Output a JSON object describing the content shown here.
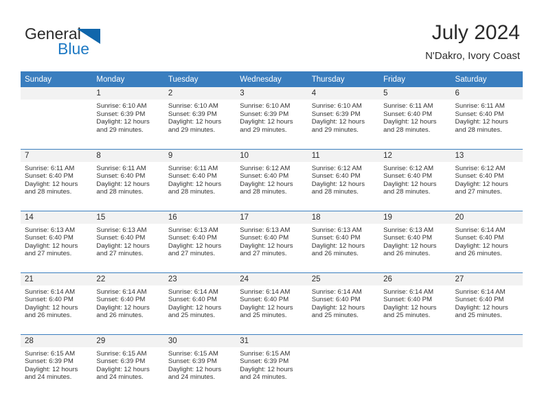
{
  "brand": {
    "name_part1": "General",
    "name_part2": "Blue",
    "triangle_icon": "triangle-icon",
    "accent_color": "#1f7ac4"
  },
  "header": {
    "title": "July 2024",
    "subtitle": "N'Dakro, Ivory Coast"
  },
  "theme": {
    "header_bg": "#3a7ebf",
    "daynum_bg": "#f2f2f2",
    "row_divider": "#3a7ebf",
    "text": "#333333"
  },
  "weekdays": [
    "Sunday",
    "Monday",
    "Tuesday",
    "Wednesday",
    "Thursday",
    "Friday",
    "Saturday"
  ],
  "weeks": [
    [
      {
        "day": "",
        "sunrise": "",
        "sunset": "",
        "daylight1": "",
        "daylight2": ""
      },
      {
        "day": "1",
        "sunrise": "Sunrise: 6:10 AM",
        "sunset": "Sunset: 6:39 PM",
        "daylight1": "Daylight: 12 hours",
        "daylight2": "and 29 minutes."
      },
      {
        "day": "2",
        "sunrise": "Sunrise: 6:10 AM",
        "sunset": "Sunset: 6:39 PM",
        "daylight1": "Daylight: 12 hours",
        "daylight2": "and 29 minutes."
      },
      {
        "day": "3",
        "sunrise": "Sunrise: 6:10 AM",
        "sunset": "Sunset: 6:39 PM",
        "daylight1": "Daylight: 12 hours",
        "daylight2": "and 29 minutes."
      },
      {
        "day": "4",
        "sunrise": "Sunrise: 6:10 AM",
        "sunset": "Sunset: 6:39 PM",
        "daylight1": "Daylight: 12 hours",
        "daylight2": "and 29 minutes."
      },
      {
        "day": "5",
        "sunrise": "Sunrise: 6:11 AM",
        "sunset": "Sunset: 6:40 PM",
        "daylight1": "Daylight: 12 hours",
        "daylight2": "and 28 minutes."
      },
      {
        "day": "6",
        "sunrise": "Sunrise: 6:11 AM",
        "sunset": "Sunset: 6:40 PM",
        "daylight1": "Daylight: 12 hours",
        "daylight2": "and 28 minutes."
      }
    ],
    [
      {
        "day": "7",
        "sunrise": "Sunrise: 6:11 AM",
        "sunset": "Sunset: 6:40 PM",
        "daylight1": "Daylight: 12 hours",
        "daylight2": "and 28 minutes."
      },
      {
        "day": "8",
        "sunrise": "Sunrise: 6:11 AM",
        "sunset": "Sunset: 6:40 PM",
        "daylight1": "Daylight: 12 hours",
        "daylight2": "and 28 minutes."
      },
      {
        "day": "9",
        "sunrise": "Sunrise: 6:11 AM",
        "sunset": "Sunset: 6:40 PM",
        "daylight1": "Daylight: 12 hours",
        "daylight2": "and 28 minutes."
      },
      {
        "day": "10",
        "sunrise": "Sunrise: 6:12 AM",
        "sunset": "Sunset: 6:40 PM",
        "daylight1": "Daylight: 12 hours",
        "daylight2": "and 28 minutes."
      },
      {
        "day": "11",
        "sunrise": "Sunrise: 6:12 AM",
        "sunset": "Sunset: 6:40 PM",
        "daylight1": "Daylight: 12 hours",
        "daylight2": "and 28 minutes."
      },
      {
        "day": "12",
        "sunrise": "Sunrise: 6:12 AM",
        "sunset": "Sunset: 6:40 PM",
        "daylight1": "Daylight: 12 hours",
        "daylight2": "and 28 minutes."
      },
      {
        "day": "13",
        "sunrise": "Sunrise: 6:12 AM",
        "sunset": "Sunset: 6:40 PM",
        "daylight1": "Daylight: 12 hours",
        "daylight2": "and 27 minutes."
      }
    ],
    [
      {
        "day": "14",
        "sunrise": "Sunrise: 6:13 AM",
        "sunset": "Sunset: 6:40 PM",
        "daylight1": "Daylight: 12 hours",
        "daylight2": "and 27 minutes."
      },
      {
        "day": "15",
        "sunrise": "Sunrise: 6:13 AM",
        "sunset": "Sunset: 6:40 PM",
        "daylight1": "Daylight: 12 hours",
        "daylight2": "and 27 minutes."
      },
      {
        "day": "16",
        "sunrise": "Sunrise: 6:13 AM",
        "sunset": "Sunset: 6:40 PM",
        "daylight1": "Daylight: 12 hours",
        "daylight2": "and 27 minutes."
      },
      {
        "day": "17",
        "sunrise": "Sunrise: 6:13 AM",
        "sunset": "Sunset: 6:40 PM",
        "daylight1": "Daylight: 12 hours",
        "daylight2": "and 27 minutes."
      },
      {
        "day": "18",
        "sunrise": "Sunrise: 6:13 AM",
        "sunset": "Sunset: 6:40 PM",
        "daylight1": "Daylight: 12 hours",
        "daylight2": "and 26 minutes."
      },
      {
        "day": "19",
        "sunrise": "Sunrise: 6:13 AM",
        "sunset": "Sunset: 6:40 PM",
        "daylight1": "Daylight: 12 hours",
        "daylight2": "and 26 minutes."
      },
      {
        "day": "20",
        "sunrise": "Sunrise: 6:14 AM",
        "sunset": "Sunset: 6:40 PM",
        "daylight1": "Daylight: 12 hours",
        "daylight2": "and 26 minutes."
      }
    ],
    [
      {
        "day": "21",
        "sunrise": "Sunrise: 6:14 AM",
        "sunset": "Sunset: 6:40 PM",
        "daylight1": "Daylight: 12 hours",
        "daylight2": "and 26 minutes."
      },
      {
        "day": "22",
        "sunrise": "Sunrise: 6:14 AM",
        "sunset": "Sunset: 6:40 PM",
        "daylight1": "Daylight: 12 hours",
        "daylight2": "and 26 minutes."
      },
      {
        "day": "23",
        "sunrise": "Sunrise: 6:14 AM",
        "sunset": "Sunset: 6:40 PM",
        "daylight1": "Daylight: 12 hours",
        "daylight2": "and 25 minutes."
      },
      {
        "day": "24",
        "sunrise": "Sunrise: 6:14 AM",
        "sunset": "Sunset: 6:40 PM",
        "daylight1": "Daylight: 12 hours",
        "daylight2": "and 25 minutes."
      },
      {
        "day": "25",
        "sunrise": "Sunrise: 6:14 AM",
        "sunset": "Sunset: 6:40 PM",
        "daylight1": "Daylight: 12 hours",
        "daylight2": "and 25 minutes."
      },
      {
        "day": "26",
        "sunrise": "Sunrise: 6:14 AM",
        "sunset": "Sunset: 6:40 PM",
        "daylight1": "Daylight: 12 hours",
        "daylight2": "and 25 minutes."
      },
      {
        "day": "27",
        "sunrise": "Sunrise: 6:14 AM",
        "sunset": "Sunset: 6:40 PM",
        "daylight1": "Daylight: 12 hours",
        "daylight2": "and 25 minutes."
      }
    ],
    [
      {
        "day": "28",
        "sunrise": "Sunrise: 6:15 AM",
        "sunset": "Sunset: 6:39 PM",
        "daylight1": "Daylight: 12 hours",
        "daylight2": "and 24 minutes."
      },
      {
        "day": "29",
        "sunrise": "Sunrise: 6:15 AM",
        "sunset": "Sunset: 6:39 PM",
        "daylight1": "Daylight: 12 hours",
        "daylight2": "and 24 minutes."
      },
      {
        "day": "30",
        "sunrise": "Sunrise: 6:15 AM",
        "sunset": "Sunset: 6:39 PM",
        "daylight1": "Daylight: 12 hours",
        "daylight2": "and 24 minutes."
      },
      {
        "day": "31",
        "sunrise": "Sunrise: 6:15 AM",
        "sunset": "Sunset: 6:39 PM",
        "daylight1": "Daylight: 12 hours",
        "daylight2": "and 24 minutes."
      },
      {
        "day": "",
        "sunrise": "",
        "sunset": "",
        "daylight1": "",
        "daylight2": ""
      },
      {
        "day": "",
        "sunrise": "",
        "sunset": "",
        "daylight1": "",
        "daylight2": ""
      },
      {
        "day": "",
        "sunrise": "",
        "sunset": "",
        "daylight1": "",
        "daylight2": ""
      }
    ]
  ]
}
